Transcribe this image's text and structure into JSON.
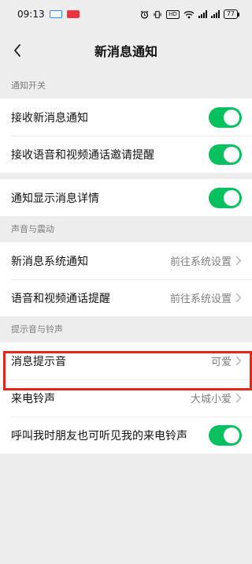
{
  "colors": {
    "accent": "#07c160",
    "highlight": "#e1271b"
  },
  "status_bar": {
    "time": "09:13",
    "left_icons": [
      "app-notification-icon",
      "app-notification-icon"
    ],
    "right_icons": [
      "alarm-icon",
      "vibrate-icon",
      "nfc-icon",
      "wifi-icon",
      "signal-icon",
      "signal-icon",
      "battery-icon"
    ],
    "nfc_label": "HD",
    "battery": "77"
  },
  "header": {
    "title": "新消息通知",
    "back_icon": "chevron-left-icon"
  },
  "sections": [
    {
      "header": "通知开关",
      "groups": [
        [
          {
            "label": "接收新消息通知",
            "type": "toggle",
            "on": true
          },
          {
            "label": "接收语音和视频通话邀请提醒",
            "type": "toggle",
            "on": true
          }
        ],
        [
          {
            "label": "通知显示消息详情",
            "type": "toggle",
            "on": true
          }
        ]
      ]
    },
    {
      "header": "声音与震动",
      "groups": [
        [
          {
            "label": "新消息系统通知",
            "type": "link",
            "value": "前往系统设置"
          },
          {
            "label": "语音和视频通话提醒",
            "type": "link",
            "value": "前往系统设置"
          }
        ]
      ]
    },
    {
      "header": "提示音与铃声",
      "groups": [
        [
          {
            "label": "消息提示音",
            "type": "link",
            "value": "可爱"
          },
          {
            "label": "来电铃声",
            "type": "link",
            "value": "大城小爱",
            "highlighted": true
          },
          {
            "label": "呼叫我时朋友也可听见我的来电铃声",
            "type": "toggle",
            "on": true
          }
        ]
      ]
    }
  ]
}
